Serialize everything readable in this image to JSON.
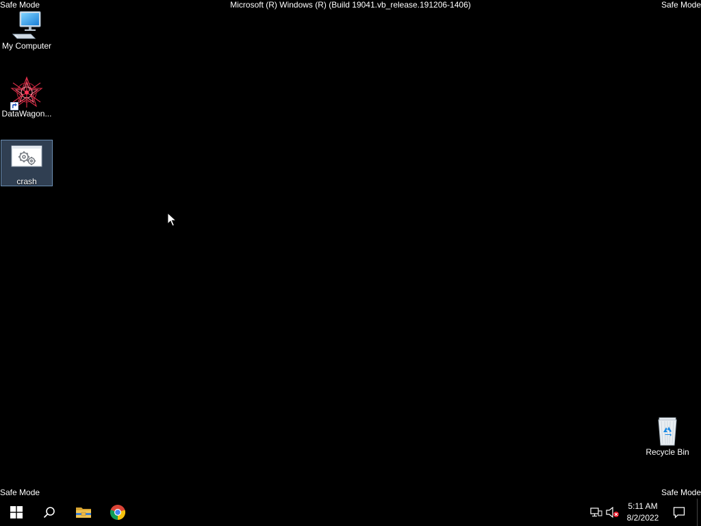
{
  "desktop": {
    "safe_mode_label": "Safe Mode",
    "build_label": "Microsoft (R) Windows (R) (Build 19041.vb_release.191206-1406)",
    "icons": [
      {
        "label": "My Computer",
        "icon": "computer-icon"
      },
      {
        "label": "DataWagon...",
        "icon": "datawagon-icon"
      },
      {
        "label": "crash",
        "icon": "crash-app-icon",
        "selected": true
      },
      {
        "label": "Recycle Bin",
        "icon": "recycle-bin-icon"
      }
    ]
  },
  "taskbar": {
    "pinned": [
      {
        "name": "Start",
        "icon": "windows-start-icon"
      },
      {
        "name": "Search",
        "icon": "search-icon"
      },
      {
        "name": "File Explorer",
        "icon": "folder-icon"
      },
      {
        "name": "Google Chrome",
        "icon": "chrome-icon"
      }
    ],
    "tray": {
      "network_icon": "network-icon",
      "volume_icon": "volume-muted-icon",
      "time": "5:11 AM",
      "date": "8/2/2022",
      "notification_icon": "action-center-icon"
    }
  },
  "colors": {
    "desktop_bg": "#000000",
    "selection_bg": "#40546e",
    "selection_border": "#6c8fb4",
    "folder_yellow": "#e8b84a",
    "windows_blue": "#ffffff"
  }
}
